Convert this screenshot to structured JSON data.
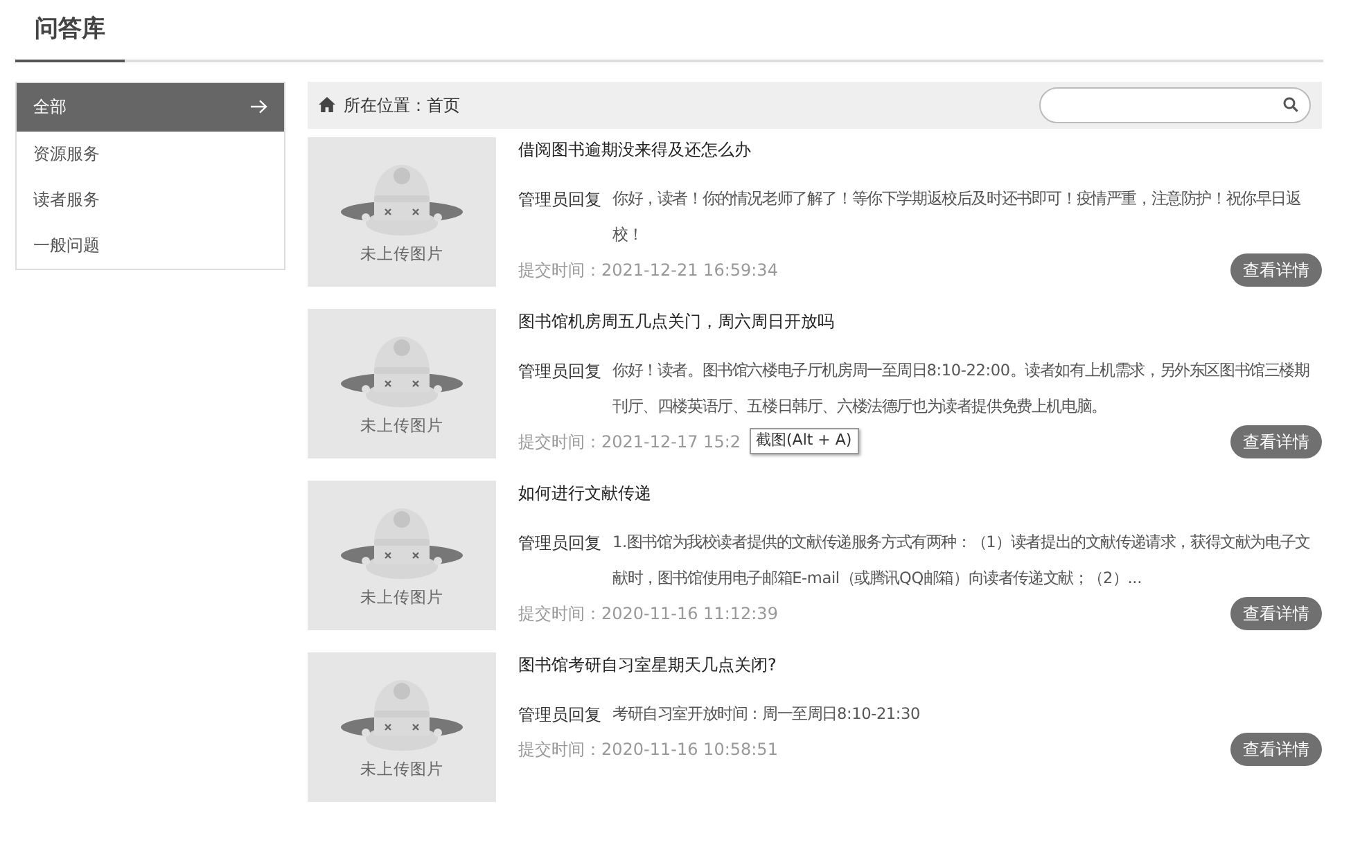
{
  "page_title": "问答库",
  "sidebar": {
    "items": [
      {
        "label": "全部",
        "selected": true
      },
      {
        "label": "资源服务",
        "selected": false
      },
      {
        "label": "读者服务",
        "selected": false
      },
      {
        "label": "一般问题",
        "selected": false
      }
    ]
  },
  "breadcrumb": {
    "text": "所在位置：首页"
  },
  "questions": [
    {
      "image_label": "未上传图片",
      "title": "借阅图书逾期没来得及还怎么办",
      "reply_label": "管理员回复",
      "reply": "你好，读者！你的情况老师了解了！等你下学期返校后及时还书即可！疫情严重，注意防护！祝你早日返校！",
      "time": "提交时间：2021-12-21 16:59:34",
      "button": "查看详情"
    },
    {
      "image_label": "未上传图片",
      "title": "图书馆机房周五几点关门，周六周日开放吗",
      "reply_label": "管理员回复",
      "reply": "你好！读者。图书馆六楼电子厅机房周一至周日8:10-22:00。读者如有上机需求，另外东区图书馆三楼期刊厅、四楼英语厅、五楼日韩厅、六楼法德厅也为读者提供免费上机电脑。",
      "time": "提交时间：2021-12-17 15:2",
      "tooltip": "截图(Alt + A)",
      "button": "查看详情"
    },
    {
      "image_label": "未上传图片",
      "title": "如何进行文献传递",
      "reply_label": "管理员回复",
      "reply": "1.图书馆为我校读者提供的文献传递服务方式有两种：（1）读者提出的文献传递请求，获得文献为电子文献时，图书馆使用电子邮箱E-mail（或腾讯QQ邮箱）向读者传递文献；（2）...",
      "time": "提交时间：2020-11-16 11:12:39",
      "button": "查看详情"
    },
    {
      "image_label": "未上传图片",
      "title": "图书馆考研自习室星期天几点关闭?",
      "reply_label": "管理员回复",
      "reply": "考研自习室开放时间：周一至周日8:10-21:30",
      "time": "提交时间：2020-11-16 10:58:51",
      "button": "查看详情"
    }
  ]
}
